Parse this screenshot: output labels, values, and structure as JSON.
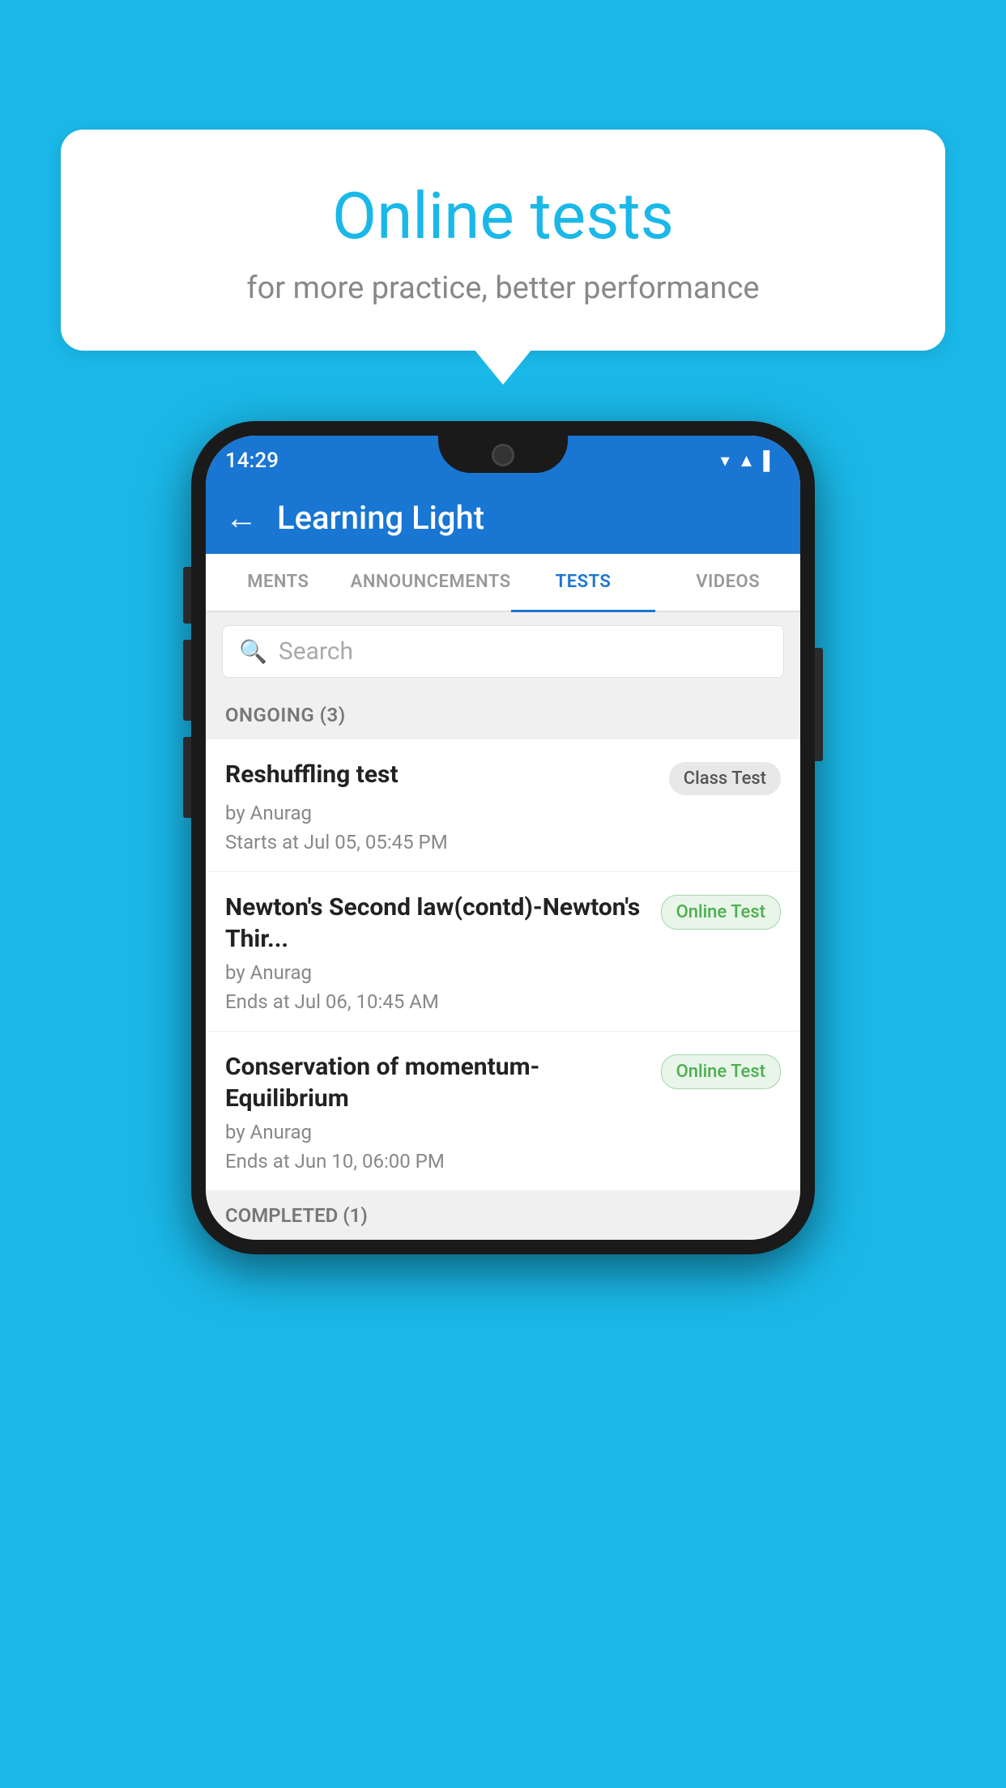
{
  "background_color": "#1ab8e8",
  "bubble": {
    "title": "Online tests",
    "subtitle": "for more practice, better performance"
  },
  "status_bar": {
    "time": "14:29",
    "icons": [
      "▾",
      "▲",
      "▌"
    ]
  },
  "app_bar": {
    "title": "Learning Light",
    "back_label": "←"
  },
  "tabs": [
    {
      "label": "MENTS",
      "active": false
    },
    {
      "label": "ANNOUNCEMENTS",
      "active": false
    },
    {
      "label": "TESTS",
      "active": true
    },
    {
      "label": "VIDEOS",
      "active": false
    }
  ],
  "search": {
    "placeholder": "Search"
  },
  "sections": [
    {
      "header": "ONGOING (3)",
      "items": [
        {
          "name": "Reshuffling test",
          "badge": "Class Test",
          "badge_type": "class",
          "by": "by Anurag",
          "date": "Starts at  Jul 05, 05:45 PM"
        },
        {
          "name": "Newton's Second law(contd)-Newton's Thir...",
          "badge": "Online Test",
          "badge_type": "online",
          "by": "by Anurag",
          "date": "Ends at  Jul 06, 10:45 AM"
        },
        {
          "name": "Conservation of momentum-Equilibrium",
          "badge": "Online Test",
          "badge_type": "online",
          "by": "by Anurag",
          "date": "Ends at  Jun 10, 06:00 PM"
        }
      ]
    },
    {
      "header": "COMPLETED (1)",
      "items": []
    }
  ]
}
